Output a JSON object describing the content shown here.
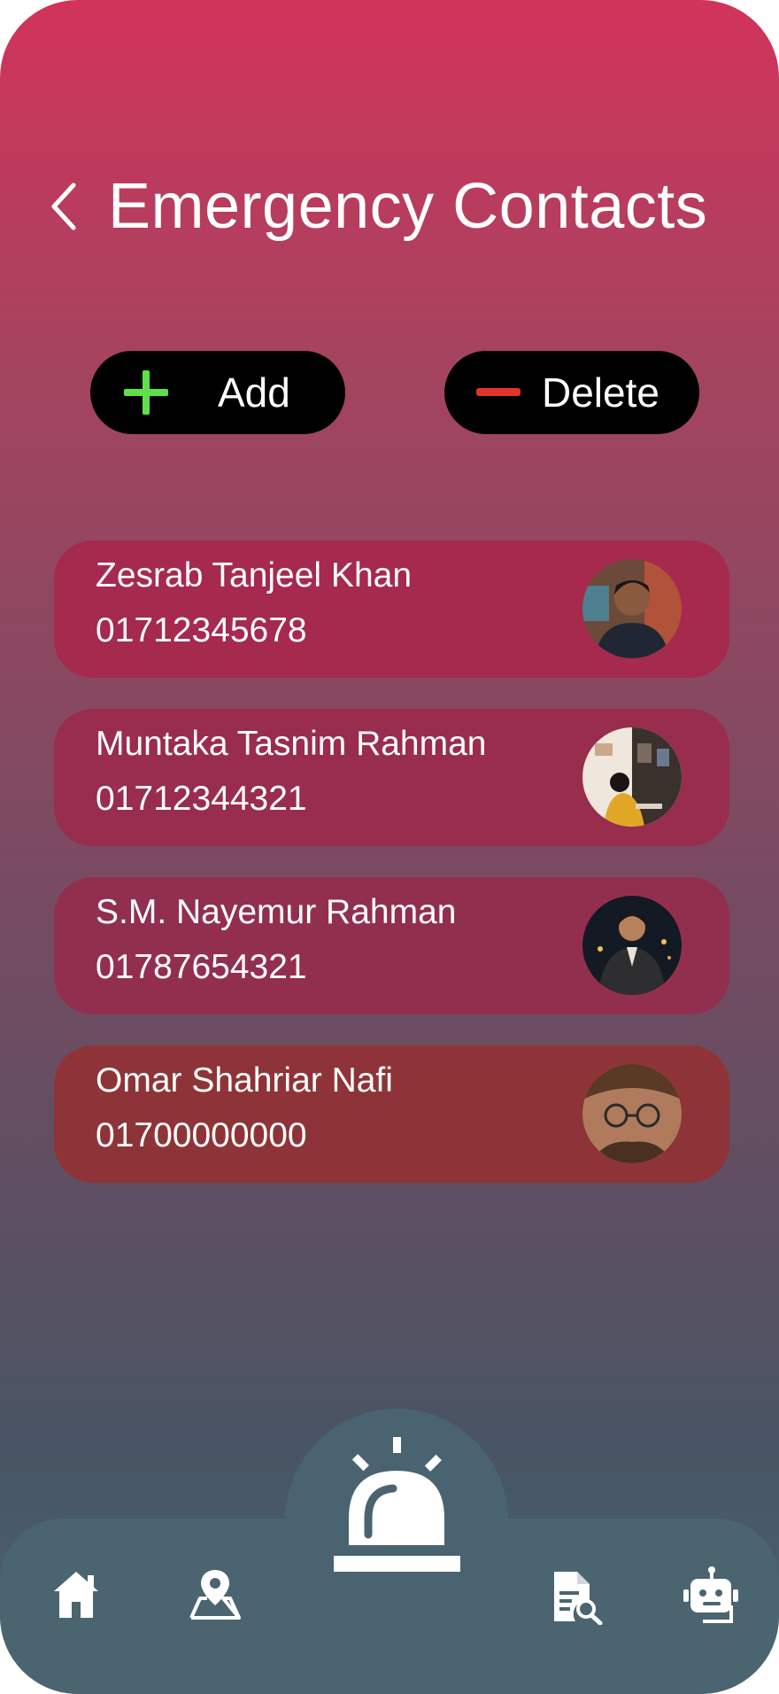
{
  "header": {
    "title": "Emergency Contacts"
  },
  "actions": {
    "add_label": "Add",
    "delete_label": "Delete"
  },
  "contacts": [
    {
      "name": "Zesrab Tanjeel Khan",
      "phone": "01712345678"
    },
    {
      "name": "Muntaka Tasnim Rahman",
      "phone": "01712344321"
    },
    {
      "name": "S.M. Nayemur Rahman",
      "phone": "01787654321"
    },
    {
      "name": "Omar Shahriar Nafi",
      "phone": "01700000000"
    }
  ],
  "colors": {
    "gradient_top": "#d2335b",
    "gradient_bottom": "#4a6570",
    "button_bg": "#000000",
    "add_icon": "#5ee04a",
    "delete_icon": "#e0352a",
    "card_1": "#a6294e",
    "card_2": "#992d4e",
    "card_3": "#922f4f",
    "card_4": "#8e3438",
    "nav_bg": "#4a656f"
  },
  "icons": {
    "back": "chevron-left-icon",
    "add": "plus-icon",
    "delete": "minus-icon",
    "home": "home-icon",
    "map": "map-pin-icon",
    "sos": "alarm-siren-icon",
    "report": "document-search-icon",
    "bot": "robot-chat-icon"
  }
}
